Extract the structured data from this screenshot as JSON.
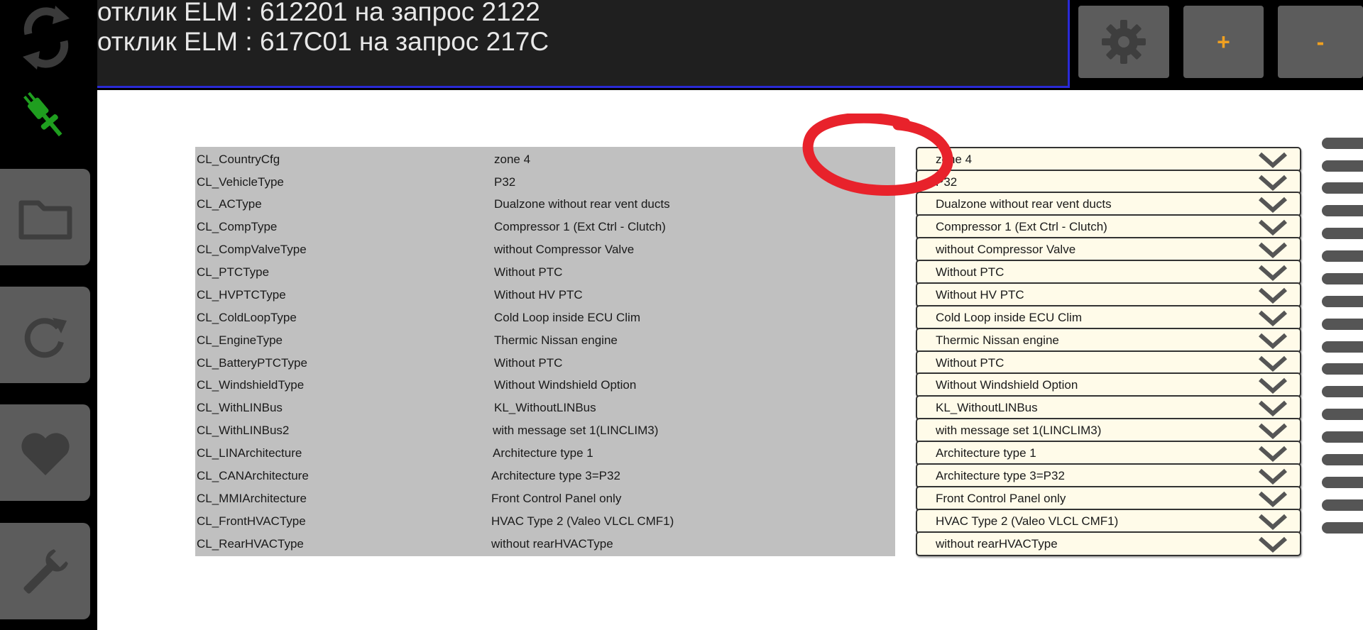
{
  "log": {
    "lines": [
      "отклик ELM : 612201 на запрос 2122",
      "отклик ELM : 617C01 на запрос 217C"
    ]
  },
  "header_buttons": {
    "plus_label": "+",
    "minus_label": "-"
  },
  "icons": {
    "sync": "sync-icon",
    "plug": "plug-icon",
    "folder": "folder-icon",
    "refresh": "refresh-icon",
    "favorite": "heart-icon",
    "tools": "wrench-icon",
    "settings": "gear-icon",
    "dropdown": "chevron-down-icon"
  },
  "colors": {
    "accent_orange": "#f0a020",
    "connected_green": "#1f9e1f",
    "annotation_red": "#e8222b",
    "log_border_blue": "#2a2ad6"
  },
  "rows": [
    {
      "name": "CL_CountryCfg",
      "current": "zone 4",
      "selected": "zone 4"
    },
    {
      "name": "CL_VehicleType",
      "current": "P32",
      "selected": "P32"
    },
    {
      "name": "CL_ACType",
      "current": "Dualzone without rear vent ducts",
      "selected": "Dualzone without rear vent ducts"
    },
    {
      "name": "CL_CompType",
      "current": "Compressor 1 (Ext Ctrl - Clutch)",
      "selected": "Compressor 1 (Ext Ctrl - Clutch)"
    },
    {
      "name": "CL_CompValveType",
      "current": "without Compressor Valve",
      "selected": "without Compressor Valve"
    },
    {
      "name": "CL_PTCType",
      "current": "Without PTC",
      "selected": "Without PTC"
    },
    {
      "name": "CL_HVPTCType",
      "current": "Without HV PTC",
      "selected": "Without HV PTC"
    },
    {
      "name": "CL_ColdLoopType",
      "current": "Cold Loop inside ECU Clim",
      "selected": "Cold Loop inside ECU Clim"
    },
    {
      "name": "CL_EngineType",
      "current": "Thermic Nissan engine",
      "selected": "Thermic Nissan engine"
    },
    {
      "name": "CL_BatteryPTCType",
      "current": "Without PTC",
      "selected": "Without PTC"
    },
    {
      "name": "CL_WindshieldType",
      "current": "Without Windshield Option",
      "selected": "Without Windshield Option"
    },
    {
      "name": "CL_WithLINBus",
      "current": "KL_WithoutLINBus",
      "selected": "KL_WithoutLINBus"
    },
    {
      "name": "CL_WithLINBus2",
      "current": "with message set 1(LINCLIM3)",
      "selected": "with message set 1(LINCLIM3)"
    },
    {
      "name": "CL_LINArchitecture",
      "current": "Architecture type 1",
      "selected": "Architecture type 1"
    },
    {
      "name": "CL_CANArchitecture",
      "current": "Architecture type 3=P32",
      "selected": "Architecture type 3=P32"
    },
    {
      "name": "CL_MMIArchitecture",
      "current": "Front Control Panel only",
      "selected": "Front Control Panel only"
    },
    {
      "name": "CL_FrontHVACType",
      "current": "HVAC Type 2 (Valeo VLCL CMF1)",
      "selected": "HVAC Type 2 (Valeo VLCL CMF1)"
    },
    {
      "name": "CL_RearHVACType",
      "current": "without rearHVACType",
      "selected": "without rearHVACType"
    }
  ]
}
